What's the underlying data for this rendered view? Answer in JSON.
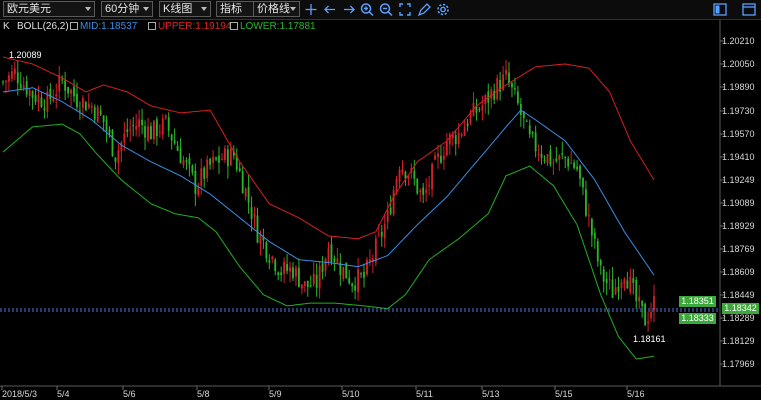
{
  "toolbar": {
    "symbol": "欧元美元",
    "period": "60分钟",
    "chart_type": "K线图",
    "indicator": "指标",
    "price_line": "价格线",
    "icons": [
      "crosshair-icon",
      "arrow-left-icon",
      "arrow-right-icon",
      "zoom-in-icon",
      "zoom-out-icon",
      "fullscreen-icon",
      "draw-pen-icon",
      "settings-icon",
      "layout-icon",
      "window-icon"
    ]
  },
  "legend": {
    "k": "K",
    "boll": "BOLL(26,2)",
    "mid": "MID:1.18537",
    "upper": "UPPER:1.19194",
    "lower": "LOWER:1.17881"
  },
  "colors": {
    "up": "#d5202a",
    "down": "#2bb52b",
    "mid": "#3a8ee6",
    "upper": "#d42020",
    "lower": "#22b022",
    "current_line": "#4a78d8",
    "tag_green": "#3ca83c"
  },
  "y_axis": [
    "1.20210",
    "1.20050",
    "1.19890",
    "1.19730",
    "1.19570",
    "1.19410",
    "1.19249",
    "1.19089",
    "1.18929",
    "1.18769",
    "1.18609",
    "1.18449",
    "1.18289",
    "1.18129",
    "1.17969"
  ],
  "x_axis": [
    "2018/5/3",
    "5/4",
    "5/6",
    "5/8",
    "5/9",
    "5/10",
    "5/11",
    "5/13",
    "5/15",
    "5/16"
  ],
  "annotations": {
    "high": "1.20089",
    "low": "1.18161"
  },
  "price_tags": {
    "tag1": "1.18351",
    "tag2": "1.18333",
    "tag3": "1.18342"
  },
  "chart_data": {
    "type": "candlestick",
    "symbol": "欧元美元",
    "period": "60分钟",
    "indicator": "BOLL(26,2)",
    "ylim": [
      1.1789,
      1.2025
    ],
    "high": 1.20089,
    "low": 1.18161,
    "last": 1.18342,
    "close_path": [
      [
        0,
        1.1992
      ],
      [
        4,
        1.1999
      ],
      [
        10,
        1.1983
      ],
      [
        15,
        1.1978
      ],
      [
        20,
        1.1993
      ],
      [
        25,
        1.198
      ],
      [
        30,
        1.1975
      ],
      [
        34,
        1.1964
      ],
      [
        38,
        1.194
      ],
      [
        42,
        1.1957
      ],
      [
        46,
        1.1963
      ],
      [
        50,
        1.1956
      ],
      [
        55,
        1.1962
      ],
      [
        60,
        1.194
      ],
      [
        65,
        1.1918
      ],
      [
        70,
        1.1932
      ],
      [
        74,
        1.1938
      ],
      [
        78,
        1.194
      ],
      [
        82,
        1.1914
      ],
      [
        86,
        1.1885
      ],
      [
        90,
        1.187
      ],
      [
        94,
        1.1857
      ],
      [
        98,
        1.1858
      ],
      [
        102,
        1.1846
      ],
      [
        106,
        1.1848
      ],
      [
        110,
        1.1875
      ],
      [
        114,
        1.186
      ],
      [
        118,
        1.185
      ],
      [
        122,
        1.1852
      ],
      [
        126,
        1.1873
      ],
      [
        130,
        1.1895
      ],
      [
        134,
        1.1935
      ],
      [
        138,
        1.1925
      ],
      [
        142,
        1.1908
      ],
      [
        146,
        1.1932
      ],
      [
        150,
        1.195
      ],
      [
        154,
        1.1955
      ],
      [
        158,
        1.1968
      ],
      [
        162,
        1.1975
      ],
      [
        166,
        1.1987
      ],
      [
        170,
        1.1995
      ],
      [
        174,
        1.1975
      ],
      [
        178,
        1.195
      ],
      [
        182,
        1.1942
      ],
      [
        186,
        1.1935
      ],
      [
        190,
        1.1938
      ],
      [
        194,
        1.193
      ],
      [
        198,
        1.1893
      ],
      [
        202,
        1.1855
      ],
      [
        206,
        1.1842
      ],
      [
        210,
        1.1858
      ],
      [
        214,
        1.1835
      ],
      [
        217,
        1.1822
      ],
      [
        220,
        1.1834
      ]
    ],
    "mid_path": [
      [
        0,
        1.1985
      ],
      [
        10,
        1.1988
      ],
      [
        20,
        1.1978
      ],
      [
        30,
        1.1965
      ],
      [
        40,
        1.1947
      ],
      [
        50,
        1.1935
      ],
      [
        60,
        1.1925
      ],
      [
        70,
        1.1912
      ],
      [
        80,
        1.1895
      ],
      [
        90,
        1.1878
      ],
      [
        100,
        1.1865
      ],
      [
        110,
        1.1863
      ],
      [
        120,
        1.186
      ],
      [
        130,
        1.1868
      ],
      [
        140,
        1.189
      ],
      [
        150,
        1.191
      ],
      [
        160,
        1.1935
      ],
      [
        170,
        1.196
      ],
      [
        175,
        1.1972
      ],
      [
        180,
        1.1965
      ],
      [
        190,
        1.195
      ],
      [
        200,
        1.1922
      ],
      [
        210,
        1.1885
      ],
      [
        220,
        1.1854
      ]
    ],
    "upper_path": [
      [
        0,
        1.201
      ],
      [
        10,
        1.2005
      ],
      [
        20,
        1.1995
      ],
      [
        28,
        1.1985
      ],
      [
        34,
        1.199
      ],
      [
        42,
        1.1985
      ],
      [
        50,
        1.1975
      ],
      [
        60,
        1.197
      ],
      [
        70,
        1.1972
      ],
      [
        80,
        1.1935
      ],
      [
        90,
        1.1905
      ],
      [
        100,
        1.1895
      ],
      [
        110,
        1.1882
      ],
      [
        120,
        1.188
      ],
      [
        126,
        1.1885
      ],
      [
        132,
        1.191
      ],
      [
        140,
        1.1935
      ],
      [
        150,
        1.195
      ],
      [
        160,
        1.1975
      ],
      [
        170,
        1.199
      ],
      [
        180,
        1.2003
      ],
      [
        190,
        1.2005
      ],
      [
        198,
        1.2002
      ],
      [
        205,
        1.1985
      ],
      [
        212,
        1.195
      ],
      [
        220,
        1.1922
      ]
    ],
    "lower_path": [
      [
        0,
        1.1942
      ],
      [
        10,
        1.196
      ],
      [
        20,
        1.1962
      ],
      [
        26,
        1.1955
      ],
      [
        32,
        1.194
      ],
      [
        40,
        1.1922
      ],
      [
        50,
        1.1905
      ],
      [
        58,
        1.1898
      ],
      [
        66,
        1.1895
      ],
      [
        72,
        1.1885
      ],
      [
        80,
        1.186
      ],
      [
        88,
        1.184
      ],
      [
        96,
        1.1832
      ],
      [
        104,
        1.1834
      ],
      [
        112,
        1.1834
      ],
      [
        122,
        1.1832
      ],
      [
        130,
        1.183
      ],
      [
        136,
        1.184
      ],
      [
        144,
        1.1865
      ],
      [
        154,
        1.188
      ],
      [
        164,
        1.1898
      ],
      [
        170,
        1.1925
      ],
      [
        178,
        1.1932
      ],
      [
        186,
        1.1918
      ],
      [
        194,
        1.189
      ],
      [
        202,
        1.184
      ],
      [
        208,
        1.181
      ],
      [
        214,
        1.1794
      ],
      [
        220,
        1.1796
      ]
    ]
  }
}
